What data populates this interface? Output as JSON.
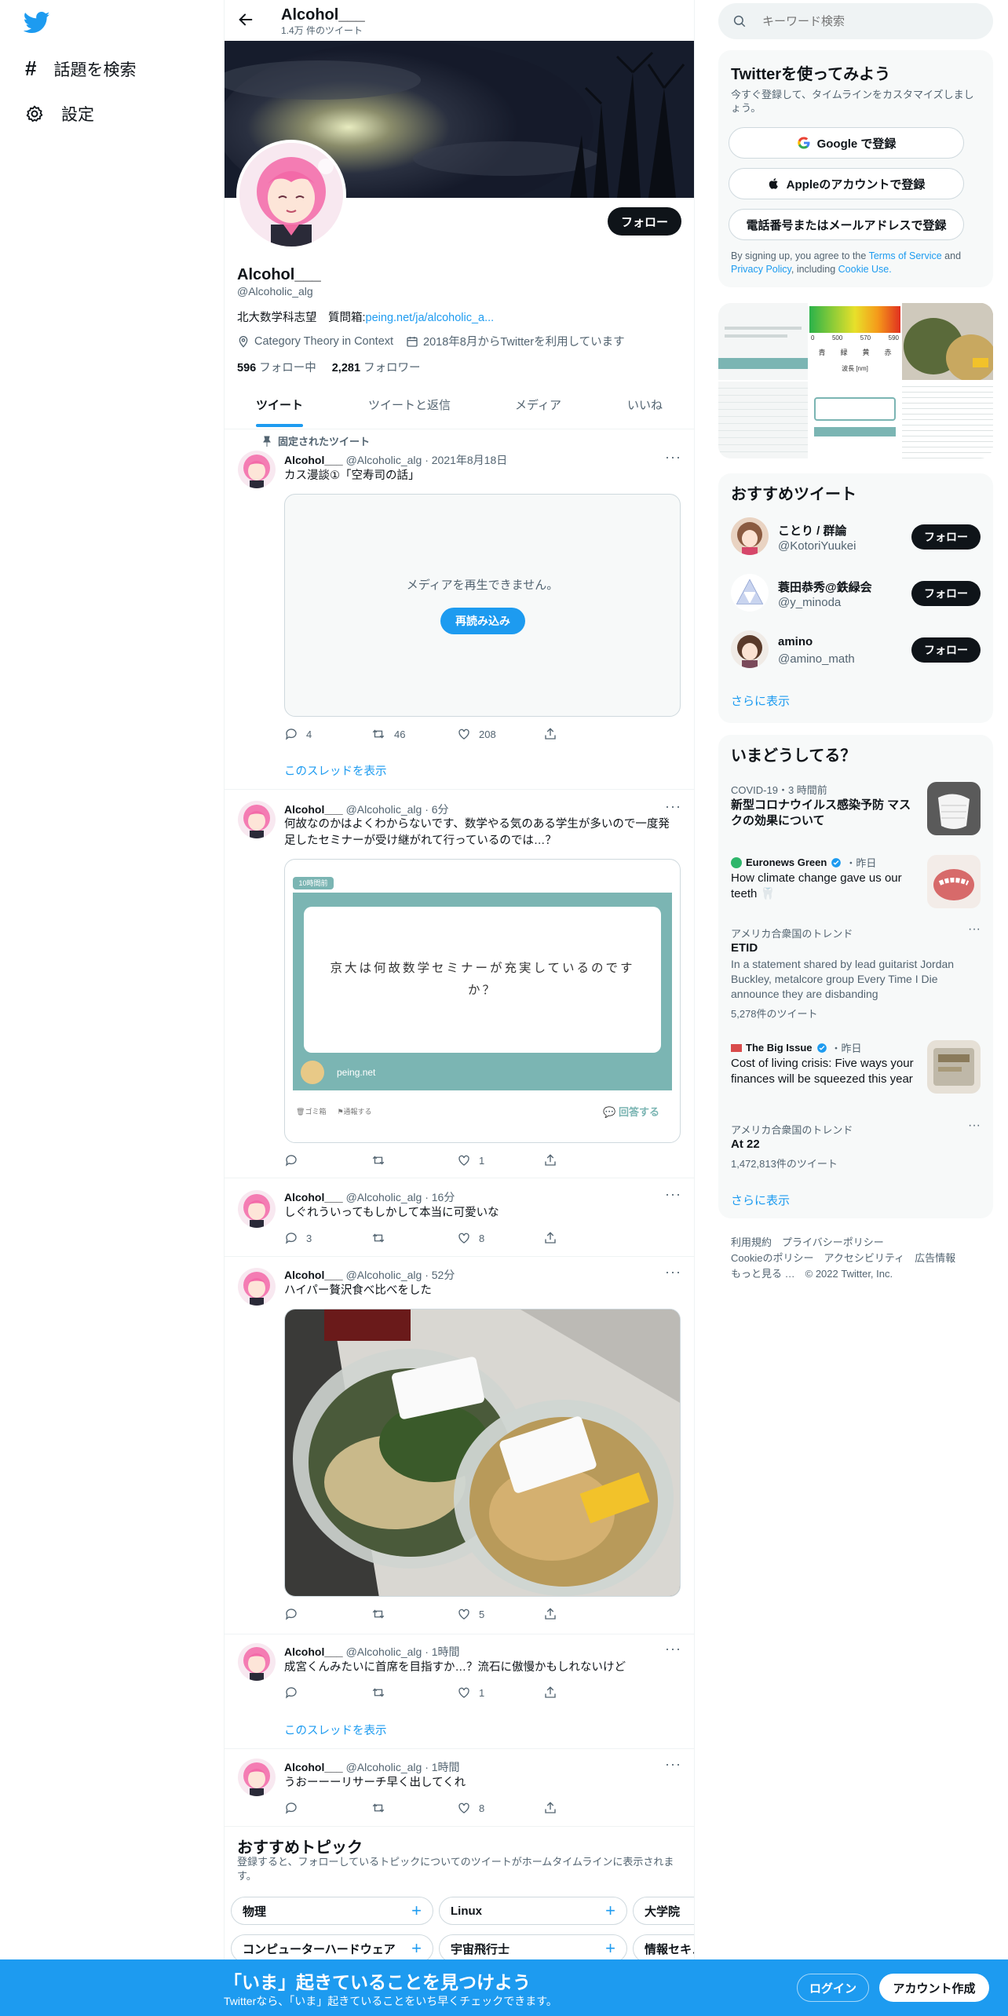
{
  "nav": {
    "explore_label": "話題を検索",
    "settings_label": "設定"
  },
  "header": {
    "title": "Alcohol___",
    "tweet_count": "1.4万 件のツイート"
  },
  "profile": {
    "name": "Alcohol___",
    "handle": "@Alcoholic_alg",
    "bio_text": "北大数学科志望　質問箱:",
    "bio_link": "peing.net/ja/alcoholic_a...",
    "location": "Category Theory in Context",
    "joined": "2018年8月からTwitterを利用しています",
    "following_count": "596",
    "following_label": "フォロー中",
    "followers_count": "2,281",
    "followers_label": "フォロワー",
    "follow_button": "フォロー"
  },
  "tabs": [
    "ツイート",
    "ツイートと返信",
    "メディア",
    "いいね"
  ],
  "tweets": [
    {
      "pinned_label": "固定されたツイート",
      "name": "Alcohol___",
      "meta": "@Alcoholic_alg · 2021年8月18日",
      "text": "カス漫談①「空寿司の話」",
      "media_error": "メディアを再生できません。",
      "reload_label": "再読み込み",
      "replies": "4",
      "retweets": "46",
      "likes": "208",
      "thread_link": "このスレッドを表示"
    },
    {
      "name": "Alcohol___",
      "meta": "@Alcoholic_alg · 6分",
      "text": "何故なのかはよくわからないです、数学やる気のある学生が多いので一度発足したセミナーが受け継がれて行っているのでは…？",
      "card_badge": "10時間前",
      "card_question": "京大は何故数学セミナーが充実しているのですか？",
      "card_site": "peing.net",
      "card_trash": "ゴミ箱",
      "card_report": "通報する",
      "card_answer": "回答する",
      "replies": "",
      "retweets": "",
      "likes": "1"
    },
    {
      "name": "Alcohol___",
      "meta": "@Alcoholic_alg · 16分",
      "text": "しぐれういってもしかして本当に可愛いな",
      "replies": "3",
      "retweets": "",
      "likes": "8"
    },
    {
      "name": "Alcohol___",
      "meta": "@Alcoholic_alg · 52分",
      "text": "ハイパー贅沢食べ比べをした",
      "replies": "",
      "retweets": "",
      "likes": "5"
    },
    {
      "name": "Alcohol___",
      "meta": "@Alcoholic_alg · 1時間",
      "text": "成宮くんみたいに首席を目指すか…？流石に傲慢かもしれないけど",
      "replies": "",
      "retweets": "",
      "likes": "1",
      "thread_link": "このスレッドを表示"
    },
    {
      "name": "Alcohol___",
      "meta": "@Alcoholic_alg · 1時間",
      "text": "うおーーーリサーチ早く出してくれ",
      "replies": "",
      "retweets": "",
      "likes": "8"
    }
  ],
  "topics": {
    "title": "おすすめトピック",
    "desc": "登録すると、フォローしているトピックについてのツイートがホームタイムラインに表示されます。",
    "row1": [
      "物理",
      "Linux",
      "大学院"
    ],
    "row2": [
      "コンピューターハードウェア",
      "宇宙飛行士",
      "情報セキュ"
    ]
  },
  "search": {
    "placeholder": "キーワード検索"
  },
  "signup": {
    "title": "Twitterを使ってみよう",
    "desc": "今すぐ登録して、タイムラインをカスタマイズしましょう。",
    "google": "Google で登録",
    "apple": "Appleのアカウントで登録",
    "phone": "電話番号またはメールアドレスで登録",
    "terms_pre": "By signing up, you agree to the ",
    "terms_link": "Terms of Service",
    "terms_and": " and ",
    "privacy_link": "Privacy Policy",
    "including": ", including ",
    "cookie_link": "Cookie Use."
  },
  "media_grid": {
    "chart_labels": [
      "青",
      "緑",
      "黄",
      "赤"
    ],
    "chart_ticks": [
      "0",
      "500",
      "570",
      "590"
    ],
    "chart_label_bottom": "波長 [nm]"
  },
  "who_to_follow": {
    "title": "おすすめツイート",
    "users": [
      {
        "name": "ことり / 群論",
        "handle": "@KotoriYuukei"
      },
      {
        "name": "蓑田恭秀@鉄緑会",
        "handle": "@y_minoda"
      },
      {
        "name": "amino",
        "handle": "@amino_math"
      }
    ],
    "follow_label": "フォロー",
    "more": "さらに表示"
  },
  "trends": {
    "title": "いまどうしてる？",
    "items": [
      {
        "meta": "COVID-19・3 時間前",
        "title": "新型コロナウイルス感染予防 マスクの効果について"
      },
      {
        "meta": "Euronews Green",
        "meta2": "・昨日",
        "title": "How climate change gave us our teeth 🦷"
      },
      {
        "meta": "アメリカ合衆国のトレンド",
        "title": "ETID",
        "body": "In a statement shared by lead guitarist Jordan Buckley, metalcore group Every Time I Die announce they are disbanding",
        "count": "5,278件のツイート"
      },
      {
        "meta": "The Big Issue",
        "meta2": "・昨日",
        "title": "Cost of living crisis: Five ways your finances will be squeezed this year"
      },
      {
        "meta": "アメリカ合衆国のトレンド",
        "title": "At 22",
        "count": "1,472,813件のツイート"
      }
    ],
    "more": "さらに表示"
  },
  "footer": {
    "line1": [
      "利用規約",
      "プライバシーポリシー"
    ],
    "line2": [
      "Cookieのポリシー",
      "アクセシビリティ",
      "広告情報"
    ],
    "line3": [
      "もっと見る …",
      "© 2022 Twitter, Inc."
    ]
  },
  "bottombar": {
    "title": "「いま」起きていることを見つけよう",
    "sub": "Twitterなら、「いま」起きていることをいち早くチェックできます。",
    "login": "ログイン",
    "signup": "アカウント作成"
  },
  "colors": {
    "accent": "#1d9bf0",
    "text": "#0f1419",
    "secondary": "#536471",
    "verified": "#1d9bf0"
  }
}
